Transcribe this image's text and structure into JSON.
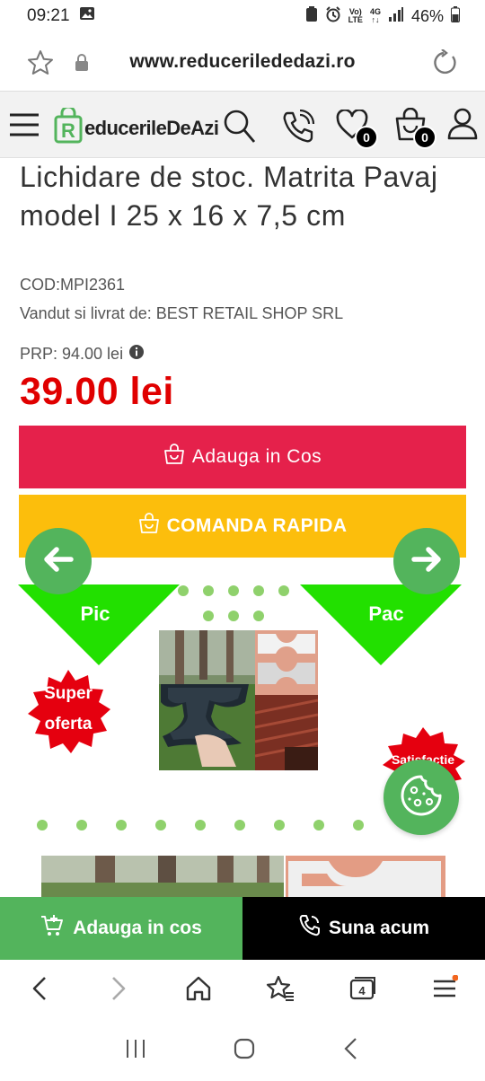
{
  "status": {
    "time": "09:21",
    "network": "4G",
    "network_sub": "LTE",
    "volte": "Vo)",
    "battery": "46%"
  },
  "browser": {
    "url": "www.reducerilededazi.ro"
  },
  "header": {
    "logo_text": "educerileDeAzi",
    "logo_letter": "R",
    "wishlist_count": "0",
    "cart_count": "0"
  },
  "product": {
    "title": "Lichidare de stoc. Matrita Pavaj model I 25 x 16 x 7,5 cm",
    "cod": "COD:MPI2361",
    "seller": "Vandut si livrat de: BEST RETAIL SHOP SRL",
    "prp": "PRP: 94.00 lei",
    "price": "39.00 lei",
    "add_to_cart": "Adauga in Cos",
    "quick_order": "COMANDA RAPIDA"
  },
  "promo": {
    "left_label": "Pic",
    "right_label": "Pac",
    "super_line1": "Super",
    "super_line2": "oferta",
    "satisfaction": "Satisfactie"
  },
  "bottombar": {
    "add_cart": "Adauga in cos",
    "call": "Suna acum"
  },
  "colors": {
    "red": "#e5214b",
    "yellow": "#fcbe0c",
    "green": "#53b45c",
    "price": "#e00000",
    "lime": "#22e000"
  }
}
